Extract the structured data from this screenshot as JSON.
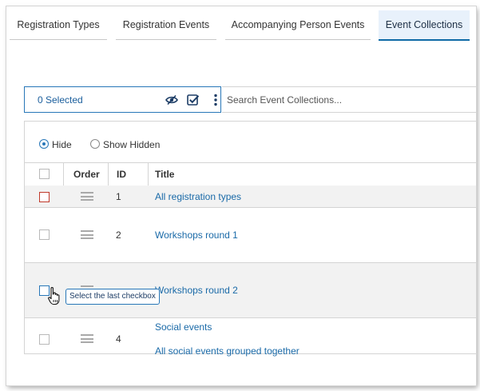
{
  "tabs": [
    {
      "label": "Registration Types",
      "active": false
    },
    {
      "label": "Registration Events",
      "active": false
    },
    {
      "label": "Accompanying Person Events",
      "active": false
    },
    {
      "label": "Event Collections",
      "active": true
    }
  ],
  "toolbar": {
    "selected_text": "0 Selected",
    "icons": [
      "eye-hidden-icon",
      "checkbox-check-icon",
      "more-vertical-icon"
    ],
    "search_placeholder": "Search Event Collections...",
    "accent_color": "#2877b8"
  },
  "filter": {
    "options": [
      {
        "label": "Hide",
        "selected": true
      },
      {
        "label": "Show Hidden",
        "selected": false
      }
    ]
  },
  "table": {
    "columns": {
      "order": "Order",
      "id": "ID",
      "title": "Title"
    },
    "rows": [
      {
        "id": "1",
        "title": "All registration types",
        "description": "",
        "checked": false,
        "highlighted": true
      },
      {
        "id": "2",
        "title": "Workshops round 1",
        "description": "",
        "checked": false,
        "highlighted": false
      },
      {
        "id": "",
        "title": "Workshops round 2",
        "description": "",
        "checked": false,
        "highlighted": false
      },
      {
        "id": "4",
        "title": "Social events",
        "description": "All social events grouped together",
        "checked": false,
        "highlighted": false
      }
    ]
  },
  "tooltip": {
    "text": "Select the last checkbox"
  },
  "colors": {
    "link": "#1a6aa8",
    "highlight_border": "#c0392b",
    "row_shade": "#f2f2f2"
  }
}
